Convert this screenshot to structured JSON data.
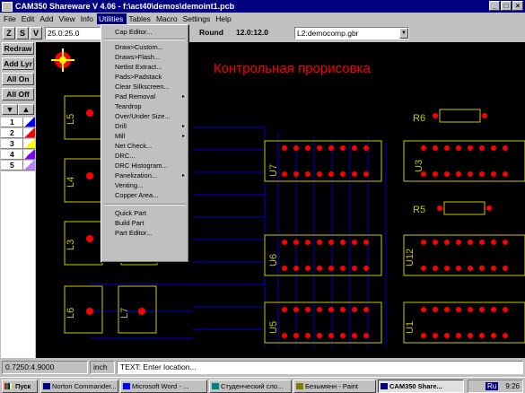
{
  "window": {
    "title": "CAM350 Shareware V 4.06 - f:\\act40\\demos\\demoint1.pcb",
    "controls": [
      "_",
      "□",
      "×"
    ]
  },
  "menubar": [
    {
      "label": "File"
    },
    {
      "label": "Edit"
    },
    {
      "label": "Add"
    },
    {
      "label": "View"
    },
    {
      "label": "Info"
    },
    {
      "label": "Utilities",
      "active": true
    },
    {
      "label": "Tables"
    },
    {
      "label": "Macro"
    },
    {
      "label": "Settings"
    },
    {
      "label": "Help"
    }
  ],
  "toolbar": {
    "z": "Z",
    "s": "S",
    "v": "V",
    "coord": "25.0:25.0",
    "shape": "Round",
    "size": "12.0:12.0",
    "layer": "L2:democomp.gbr"
  },
  "leftpanel": {
    "redraw": "Redraw",
    "add_layer": "Add Lyr",
    "all_on": "All On",
    "all_off": "All Off",
    "down": "▼",
    "up": "▲",
    "layers": [
      {
        "num": "1",
        "color": "#0000ff",
        "accent": "#ff0000"
      },
      {
        "num": "2",
        "color": "#ff0000",
        "accent": "#ffffff"
      },
      {
        "num": "3",
        "color": "#ffff00",
        "accent": "#ffffff"
      },
      {
        "num": "4",
        "color": "#8000ff",
        "accent": "#ffffff"
      },
      {
        "num": "5",
        "color": "#c080ff",
        "accent": "#ffffff"
      }
    ]
  },
  "canvas": {
    "title": "Контрольная прорисовка",
    "components": [
      "L5",
      "L4",
      "L3",
      "L7",
      "L6",
      "R6",
      "U7",
      "U3",
      "R5",
      "U6",
      "U12",
      "U5",
      "U1"
    ]
  },
  "utilities_menu": [
    {
      "label": "Cap Editor..."
    },
    {
      "sep": true
    },
    {
      "label": "Draw>Custom..."
    },
    {
      "label": "Draws>Flash..."
    },
    {
      "label": "Netlist Extract..."
    },
    {
      "label": "Pads>Padstack"
    },
    {
      "label": "Clear Silkscreen..."
    },
    {
      "label": "Pad Removal",
      "sub": "▸"
    },
    {
      "label": "Teardrop"
    },
    {
      "label": "Over/Under Size..."
    },
    {
      "label": "Drill",
      "sub": "▸"
    },
    {
      "label": "Mill",
      "sub": "▸"
    },
    {
      "label": "Net Check..."
    },
    {
      "label": "DRC..."
    },
    {
      "label": "DRC Histogram..."
    },
    {
      "label": "Panelization...",
      "sub": "▸"
    },
    {
      "label": "Venting..."
    },
    {
      "label": "Copper Area..."
    },
    {
      "sep": true
    },
    {
      "label": "Quick Part"
    },
    {
      "label": "Build Part"
    },
    {
      "label": "Part Editor..."
    }
  ],
  "statusbar": {
    "coords": "0.7250:4.9000",
    "units": "inch",
    "message": "TEXT: Enter location..."
  },
  "taskbar": {
    "start": "Пуск",
    "tasks": [
      {
        "label": "Norton Commander...",
        "icon_color": "#000080"
      },
      {
        "label": "Microsoft Word - ...",
        "icon_color": "#0000ff"
      },
      {
        "label": "Студенческий сло...",
        "icon_color": "#008080"
      },
      {
        "label": "Безымянн - Paint",
        "icon_color": "#808000"
      },
      {
        "label": "CAM350 Share...",
        "icon_color": "#000080",
        "active": true
      }
    ],
    "lang": "Ru",
    "clock": "9:26"
  }
}
